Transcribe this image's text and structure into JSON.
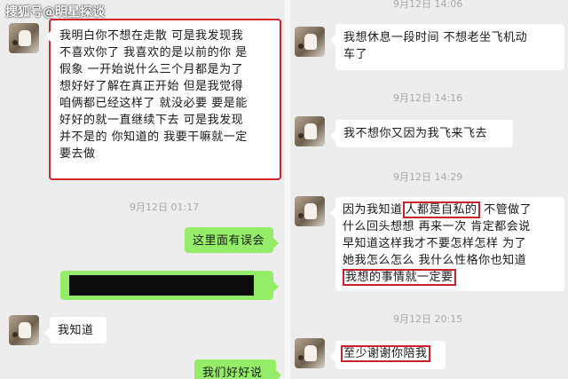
{
  "watermark": "搜狐号@明星探谈",
  "left_chat": {
    "messages": [
      {
        "lines": [
          "我明白你不想在走散 可是我发现我",
          "不喜欢你了 我喜欢的是以前的你 是",
          "假象 一开始说什么三个月都是为了",
          "想好好了解在真正开始 但是我觉得",
          "咱俩都已经这样了 就没必要 要是能",
          "好好的就一直继续下去 可是我发现",
          "并不是的 你知道的 我要干嘛就一定",
          "要去做"
        ]
      },
      {
        "text": "这里面有误会"
      },
      {
        "text": "我知道"
      },
      {
        "text": "我们好好说"
      }
    ],
    "timestamps": [
      "9月12日 01:17"
    ]
  },
  "right_chat": {
    "timestamps": [
      "9月12日 14:06",
      "9月12日 14:16",
      "9月12日 14:29",
      "9月12日 20:15"
    ],
    "messages": [
      {
        "lines": [
          "我想休息一段时间 不想老坐飞机动",
          "车了"
        ]
      },
      {
        "text": "我不想你又因为我飞来飞去"
      },
      {
        "line1_pre": "因为我知道",
        "line1_hl": "人都是自私的",
        "line1_post": "不管做了",
        "lines": [
          "什么回头想想 再来一次 肯定都会说",
          "早知道这样我才不要怎样怎样 为了",
          "她我怎么怎么 我什么性格你也知道"
        ],
        "line5_hl": "我想的事情就一定要"
      },
      {
        "text": "至少谢谢你陪我"
      }
    ]
  }
}
